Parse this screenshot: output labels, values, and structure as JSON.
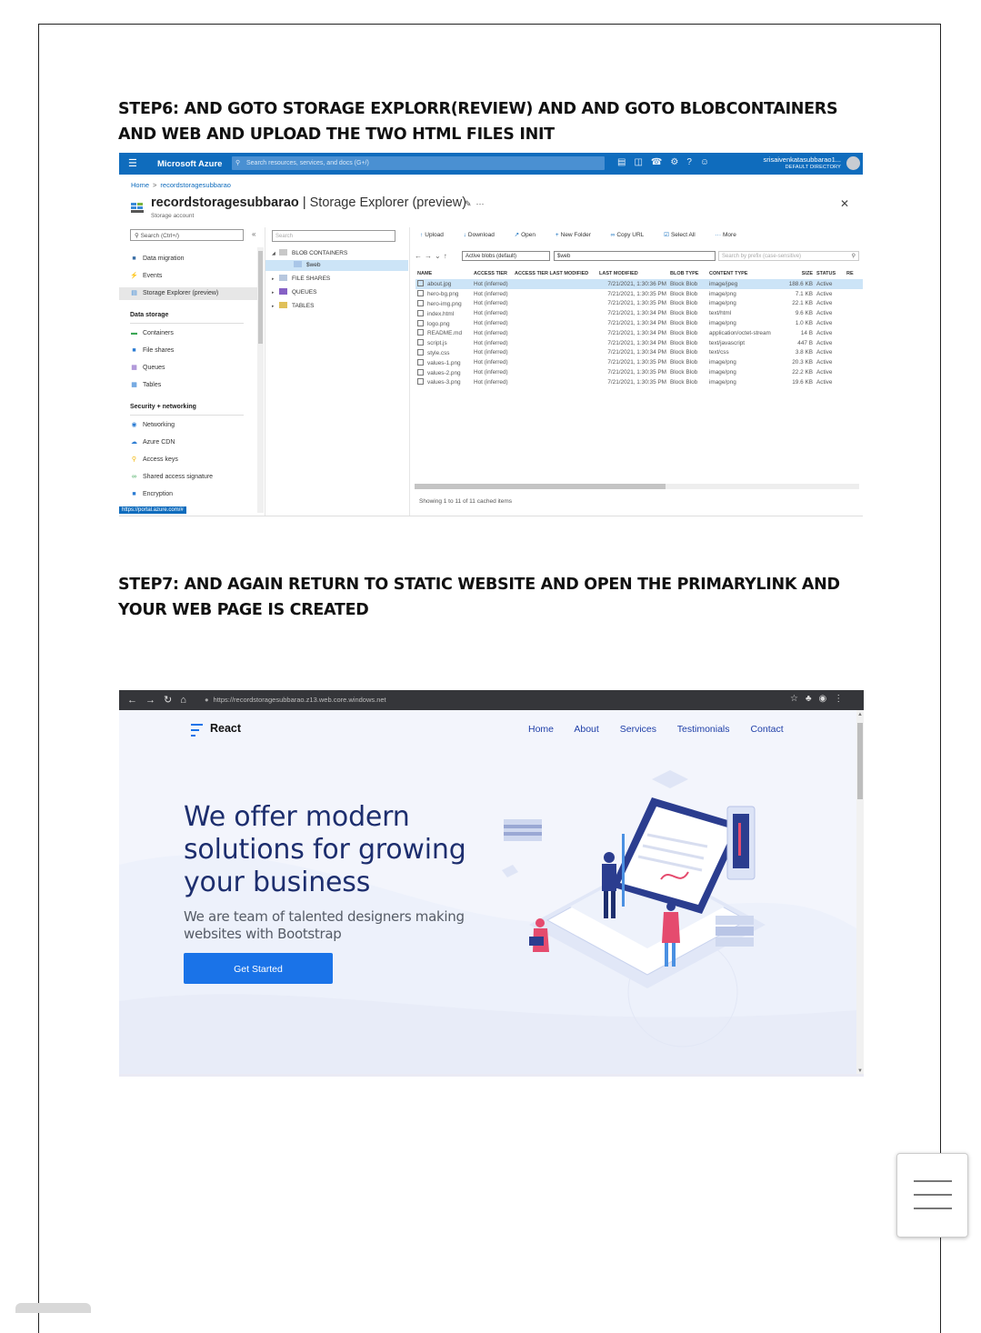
{
  "steps": {
    "step6": "STEP6: AND GOTO STORAGE EXPLORR(REVIEW) AND AND GOTO BLOBCONTAINERS AND WEB AND UPLOAD THE TWO HTML FILES INIT",
    "step7": "STEP7: AND AGAIN RETURN TO STATIC WEBSITE AND OPEN  THE PRIMARYLINK AND YOUR WEB PAGE IS CREATED"
  },
  "azure": {
    "brand": "Microsoft Azure",
    "search_placeholder": "Search resources, services, and docs (G+/)",
    "user_name": "srisaivenkatasubbarao1...",
    "user_directory": "DEFAULT DIRECTORY",
    "breadcrumb": [
      "Home",
      "recordstoragesubbarao"
    ],
    "title_resource": "recordstoragesubbarao",
    "title_page": "Storage Explorer (preview)",
    "subtitle": "Storage account",
    "nav_search": "Search (Ctrl+/)",
    "nav": {
      "top": [
        {
          "label": "Data migration",
          "icon": "data-migration-icon"
        },
        {
          "label": "Events",
          "icon": "events-icon"
        },
        {
          "label": "Storage Explorer (preview)",
          "icon": "storage-explorer-icon"
        }
      ],
      "data_storage_label": "Data storage",
      "data_storage": [
        {
          "label": "Containers",
          "icon": "containers-icon"
        },
        {
          "label": "File shares",
          "icon": "file-shares-icon"
        },
        {
          "label": "Queues",
          "icon": "queues-icon"
        },
        {
          "label": "Tables",
          "icon": "tables-icon"
        }
      ],
      "security_label": "Security + networking",
      "security": [
        {
          "label": "Networking",
          "icon": "networking-icon"
        },
        {
          "label": "Azure CDN",
          "icon": "cdn-icon"
        },
        {
          "label": "Access keys",
          "icon": "key-icon"
        },
        {
          "label": "Shared access signature",
          "icon": "link-icon"
        },
        {
          "label": "Encryption",
          "icon": "lock-icon"
        }
      ]
    },
    "status_url": "https://portal.azure.com/#",
    "tree_search": "Search",
    "tree": {
      "blob_containers": "BLOB CONTAINERS",
      "web": "$web",
      "file_shares": "FILE SHARES",
      "queues": "QUEUES",
      "tables": "TABLES"
    },
    "toolbar": [
      "Upload",
      "Download",
      "Open",
      "New Folder",
      "Copy URL",
      "Select All",
      "More"
    ],
    "filter_select": "Active blobs (default)",
    "path": "$web",
    "prefix_placeholder": "Search by prefix (case-sensitive)",
    "columns": [
      "NAME",
      "ACCESS TIER",
      "ACCESS TIER LAST MODIFIED",
      "LAST MODIFIED",
      "BLOB TYPE",
      "CONTENT TYPE",
      "SIZE",
      "STATUS",
      "RE"
    ],
    "rows": [
      {
        "name": "about.jpg",
        "tier": "Hot (inferred)",
        "modified": "7/21/2021, 1:30:36 PM",
        "type": "Block Blob",
        "content": "image/jpeg",
        "size": "188.6 KB",
        "status": "Active"
      },
      {
        "name": "hero-bg.png",
        "tier": "Hot (inferred)",
        "modified": "7/21/2021, 1:30:35 PM",
        "type": "Block Blob",
        "content": "image/png",
        "size": "7.1 KB",
        "status": "Active"
      },
      {
        "name": "hero-img.png",
        "tier": "Hot (inferred)",
        "modified": "7/21/2021, 1:30:35 PM",
        "type": "Block Blob",
        "content": "image/png",
        "size": "22.1 KB",
        "status": "Active"
      },
      {
        "name": "index.html",
        "tier": "Hot (inferred)",
        "modified": "7/21/2021, 1:30:34 PM",
        "type": "Block Blob",
        "content": "text/html",
        "size": "9.6 KB",
        "status": "Active"
      },
      {
        "name": "logo.png",
        "tier": "Hot (inferred)",
        "modified": "7/21/2021, 1:30:34 PM",
        "type": "Block Blob",
        "content": "image/png",
        "size": "1.0 KB",
        "status": "Active"
      },
      {
        "name": "README.md",
        "tier": "Hot (inferred)",
        "modified": "7/21/2021, 1:30:34 PM",
        "type": "Block Blob",
        "content": "application/octet-stream",
        "size": "14 B",
        "status": "Active"
      },
      {
        "name": "script.js",
        "tier": "Hot (inferred)",
        "modified": "7/21/2021, 1:30:34 PM",
        "type": "Block Blob",
        "content": "text/javascript",
        "size": "447 B",
        "status": "Active"
      },
      {
        "name": "style.css",
        "tier": "Hot (inferred)",
        "modified": "7/21/2021, 1:30:34 PM",
        "type": "Block Blob",
        "content": "text/css",
        "size": "3.8 KB",
        "status": "Active"
      },
      {
        "name": "values-1.png",
        "tier": "Hot (inferred)",
        "modified": "7/21/2021, 1:30:35 PM",
        "type": "Block Blob",
        "content": "image/png",
        "size": "20.3 KB",
        "status": "Active"
      },
      {
        "name": "values-2.png",
        "tier": "Hot (inferred)",
        "modified": "7/21/2021, 1:30:35 PM",
        "type": "Block Blob",
        "content": "image/png",
        "size": "22.2 KB",
        "status": "Active"
      },
      {
        "name": "values-3.png",
        "tier": "Hot (inferred)",
        "modified": "7/21/2021, 1:30:35 PM",
        "type": "Block Blob",
        "content": "image/png",
        "size": "19.6 KB",
        "status": "Active"
      }
    ],
    "footer": "Showing 1 to 11 of 11 cached items"
  },
  "browser": {
    "url": "https://recordstoragesubbarao.z13.web.core.windows.net",
    "logo": "React",
    "menu": [
      "Home",
      "About",
      "Services",
      "Testimonials",
      "Contact"
    ],
    "hero_title": "We offer modern solutions for growing your business",
    "hero_subtitle": "We are team of talented designers making websites with Bootstrap",
    "cta": "Get Started"
  },
  "colors": {
    "azure_blue": "#0f6cbd",
    "site_heading": "#1d2e6e",
    "cta_blue": "#1a73e8"
  }
}
